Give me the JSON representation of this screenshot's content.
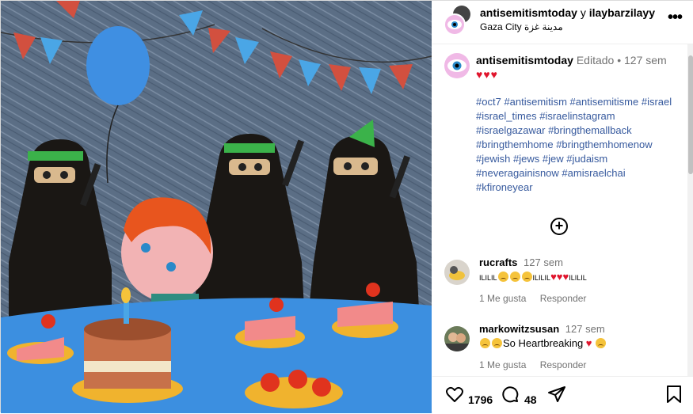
{
  "header": {
    "user1": "antisemitismtoday",
    "joiner": "y",
    "user2": "ilaybarzilayy",
    "location": "Gaza City مدينة غزة"
  },
  "caption": {
    "username": "antisemitismtoday",
    "edited": "Editado",
    "separator": "•",
    "time": "127 sem",
    "hearts": "♥♥♥",
    "hashtags": [
      "#oct7",
      "#antisemitism",
      "#antisemitisme",
      "#israel",
      "#israel_times",
      "#israelinstagram",
      "#israelgazawar",
      "#bringthemallback",
      "#bringthemhome",
      "#bringthemhomenow",
      "#jewish",
      "#jews",
      "#jew",
      "#judaism",
      "#neveragainisnow",
      "#amisraelchai",
      "#kfironeyear"
    ]
  },
  "load_more_label": "+",
  "comments": [
    {
      "username": "rucrafts",
      "time": "127 sem",
      "text_a": "ILILIL",
      "text_b": "ILILIL",
      "text_c": "ILILIL",
      "like_label": "1 Me gusta",
      "reply_label": "Responder"
    },
    {
      "username": "markowitzsusan",
      "time": "127 sem",
      "text": "So Heartbreaking",
      "like_label": "1 Me gusta",
      "reply_label": "Responder"
    }
  ],
  "actions": {
    "likes": "1796",
    "comments": "48"
  },
  "icons": [
    "more-icon",
    "like-icon",
    "comment-icon",
    "share-icon",
    "save-icon",
    "load-more-icon"
  ],
  "colors": {
    "hashtag": "#375a9e",
    "heart": "#e0142c",
    "muted": "#737373",
    "border": "#dbdbdb"
  }
}
